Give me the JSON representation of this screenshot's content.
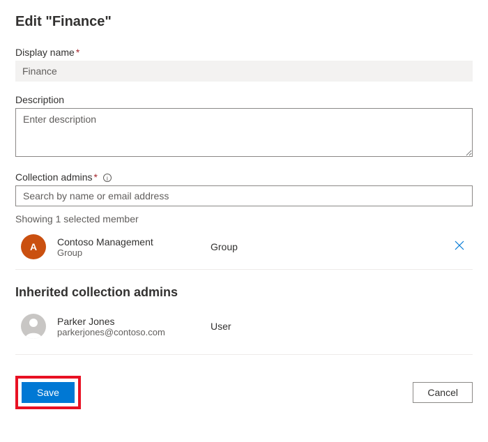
{
  "header": {
    "title": "Edit \"Finance\""
  },
  "displayName": {
    "label": "Display name",
    "required": "*",
    "value": "Finance"
  },
  "description": {
    "label": "Description",
    "placeholder": "Enter description",
    "value": ""
  },
  "admins": {
    "label": "Collection admins",
    "required": "*",
    "searchPlaceholder": "Search by name or email address",
    "showing": "Showing 1 selected member",
    "members": [
      {
        "initial": "A",
        "name": "Contoso Management",
        "sub": "Group",
        "type": "Group"
      }
    ]
  },
  "inherited": {
    "title": "Inherited collection admins",
    "members": [
      {
        "name": "Parker Jones",
        "sub": "parkerjones@contoso.com",
        "type": "User"
      }
    ]
  },
  "footer": {
    "save": "Save",
    "cancel": "Cancel"
  }
}
